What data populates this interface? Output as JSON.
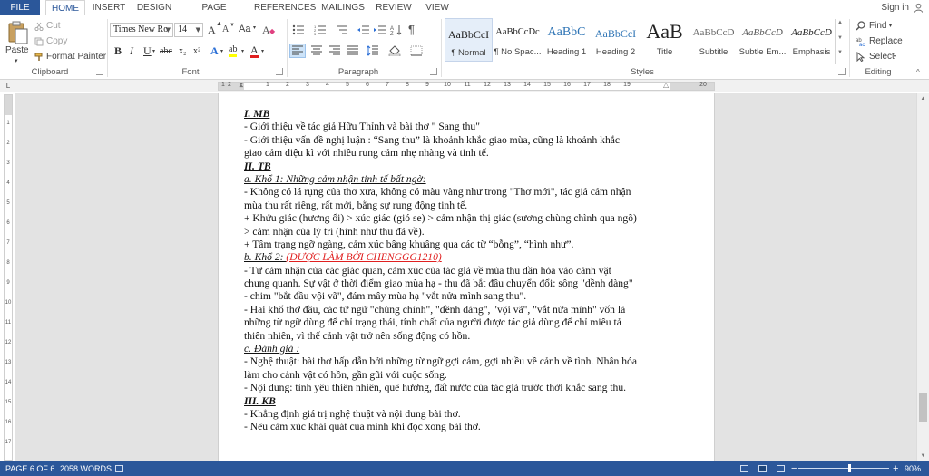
{
  "tabs": [
    "FILE",
    "HOME",
    "INSERT",
    "DESIGN",
    "PAGE LAYOUT",
    "REFERENCES",
    "MAILINGS",
    "REVIEW",
    "VIEW"
  ],
  "signin": "Sign in",
  "clipboard": {
    "label": "Clipboard",
    "paste": "Paste",
    "cut": "Cut",
    "copy": "Copy",
    "format_painter": "Format Painter"
  },
  "font": {
    "label": "Font",
    "name": "Times New Ro",
    "size": "14",
    "bold": "B",
    "italic": "I",
    "underline": "U",
    "strike": "abc",
    "subscript": "x₂",
    "superscript": "x²",
    "grow": "A",
    "shrink": "A",
    "case": "Aa",
    "clear": "A",
    "text_effect": "A",
    "highlight": "ab",
    "font_color": "A"
  },
  "paragraph": {
    "label": "Paragraph",
    "pilcrow": "¶"
  },
  "styles": {
    "label": "Styles",
    "items": [
      {
        "sample": "AaBbCcI",
        "name": "¶ Normal"
      },
      {
        "sample": "AaBbCcDc",
        "name": "¶ No Spac..."
      },
      {
        "sample": "AaBbC",
        "name": "Heading 1"
      },
      {
        "sample": "AaBbCcI",
        "name": "Heading 2"
      },
      {
        "sample": "AaB",
        "name": "Title"
      },
      {
        "sample": "AaBbCcD",
        "name": "Subtitle"
      },
      {
        "sample": "AaBbCcD",
        "name": "Subtle Em..."
      },
      {
        "sample": "AaBbCcD",
        "name": "Emphasis"
      }
    ]
  },
  "editing": {
    "label": "Editing",
    "find": "Find",
    "replace": "Replace",
    "select": "Select"
  },
  "ruler_numbers": [
    "1",
    "2",
    "1",
    "2",
    "3",
    "4",
    "5",
    "6",
    "7",
    "8",
    "9",
    "10",
    "11",
    "12",
    "13",
    "14",
    "15",
    "16",
    "17",
    "18",
    "19",
    "20"
  ],
  "vruler_numbers": [
    "1",
    "2",
    "3",
    "4",
    "5",
    "6",
    "7",
    "8",
    "9",
    "10",
    "11",
    "12",
    "13",
    "14",
    "15",
    "16",
    "17",
    "18",
    "19",
    "20",
    "21",
    "22",
    "23",
    "24"
  ],
  "document": {
    "lines": [
      {
        "t": "I. MB",
        "s": "h"
      },
      {
        "t": "- Giới thiệu về tác giả Hữu Thỉnh và bài thơ \" Sang thu\"",
        "s": ""
      },
      {
        "t": "- Giới thiệu vấn đề nghị luận : “Sang thu” là khoảnh khắc giao mùa, cũng là khoảnh khắc",
        "s": ""
      },
      {
        "t": "giao cảm diệu kì với nhiều rung cảm nhẹ nhàng và tinh tế.",
        "s": ""
      },
      {
        "t": "II. TB",
        "s": "h"
      },
      {
        "t": "a. Khổ 1: Những cảm nhận tinh tế bất ngờ:",
        "s": "sub"
      },
      {
        "t": "- Không có lá rụng của thơ xưa, không có màu vàng như trong \"Thơ mới\", tác giả cảm nhận",
        "s": ""
      },
      {
        "t": "mùa thu rất riêng, rất mới, bằng sự rung động tinh tế.",
        "s": ""
      },
      {
        "t": "+ Khứu giác (hương ổi) > xúc giác (gió se) > cảm nhận thị giác (sương chùng chình qua ngõ)",
        "s": ""
      },
      {
        "t": "> cảm nhận của lý trí (hình như thu đã về).",
        "s": ""
      },
      {
        "t": "+ Tâm trạng ngỡ ngàng, cảm xúc bâng khuâng qua các từ “bỗng”, “hình như”.",
        "s": ""
      },
      {
        "t": "b. Khổ 2: ",
        "s": "sub",
        "red": "(ĐƯỢC LÀM BỞI CHENGGG1210)"
      },
      {
        "t": "- Từ cảm nhận của các giác quan, cảm xúc của tác giả về mùa thu dần hòa vào cảnh vật",
        "s": ""
      },
      {
        "t": "chung quanh. Sự vật ở thời điểm giao mùa hạ - thu đã bắt đầu chuyển đổi: sông \"dềnh dàng\"",
        "s": ""
      },
      {
        "t": "- chim \"bắt đầu vội vã\", đám mây mùa hạ \"vắt nửa mình sang thu\".",
        "s": ""
      },
      {
        "t": "- Hai khổ thơ đầu, các từ ngữ \"chùng chình\", \"dềnh dàng\", \"vội vã\", \"vắt nửa mình\" vốn là",
        "s": ""
      },
      {
        "t": "những từ ngữ dùng để chỉ trạng thái, tính chất của người được tác giả dùng để chỉ miêu tả",
        "s": ""
      },
      {
        "t": "thiên nhiên, vì thế cảnh vật trở nên sống động có hồn.",
        "s": ""
      },
      {
        "t": "c. Đánh giá :",
        "s": "sub"
      },
      {
        "t": "- Nghệ thuật: bài thơ hấp dẫn bởi những từ ngữ gợi cảm, gợi nhiều về cảnh về tình. Nhân hóa",
        "s": ""
      },
      {
        "t": "làm cho cảnh vật có hồn, gần gũi với cuộc sống.",
        "s": ""
      },
      {
        "t": "- Nội dung: tình yêu thiên nhiên, quê hương, đất nước của tác giả trước thời khắc sang thu.",
        "s": ""
      },
      {
        "t": "III. KB",
        "s": "h"
      },
      {
        "t": "- Khẳng định giá trị nghệ thuật và nội dung bài thơ.",
        "s": ""
      },
      {
        "t": "- Nêu cảm xúc khái quát của mình khi đọc xong bài thơ.",
        "s": ""
      }
    ]
  },
  "status": {
    "page": "PAGE 6 OF 6",
    "words": "2058 WORDS",
    "zoom": "90%",
    "zoom_minus": "−",
    "zoom_plus": "+"
  },
  "colors": {
    "accent": "#2b579a",
    "red_text": "#e02020"
  },
  "icons": [
    "user-icon",
    "paste-icon",
    "cut-icon",
    "copy-icon",
    "format-painter-icon",
    "bullets-icon",
    "numbering-icon",
    "multilevel-icon",
    "decrease-indent-icon",
    "increase-indent-icon",
    "sort-icon",
    "align-left-icon",
    "align-center-icon",
    "align-right-icon",
    "justify-icon",
    "line-spacing-icon",
    "shading-icon",
    "borders-icon",
    "find-icon",
    "replace-icon",
    "select-icon",
    "read-mode-icon",
    "print-layout-icon",
    "web-layout-icon"
  ]
}
